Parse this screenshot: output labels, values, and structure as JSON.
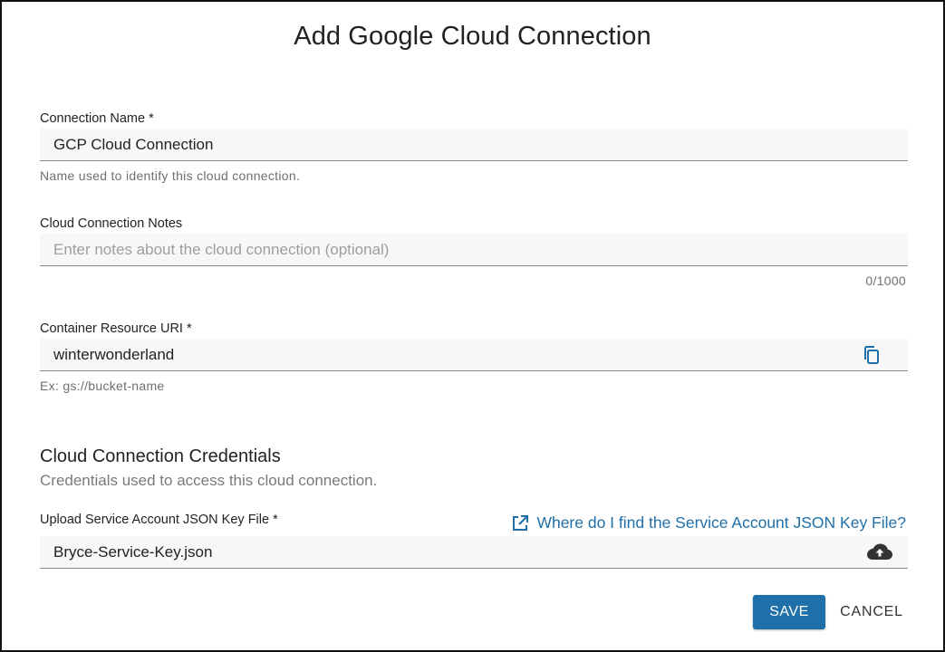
{
  "dialog": {
    "title": "Add Google Cloud Connection"
  },
  "connection_name": {
    "label": "Connection Name",
    "required_mark": "*",
    "value": "GCP Cloud Connection",
    "helper": "Name used to identify this cloud connection."
  },
  "notes": {
    "label": "Cloud Connection Notes",
    "placeholder": "Enter notes about the cloud connection (optional)",
    "counter": "0/1000"
  },
  "container_uri": {
    "label": "Container Resource URI",
    "required_mark": "*",
    "value": "winterwonderland",
    "helper": "Ex: gs://bucket-name",
    "icon": "copy-icon"
  },
  "credentials": {
    "section_title": "Cloud Connection Credentials",
    "section_subtitle": "Credentials used to access this cloud connection.",
    "upload_label": "Upload Service Account JSON Key File",
    "required_mark": "*",
    "help_link": "Where do I find the Service Account JSON Key File?",
    "help_icon": "open-in-new-icon",
    "file_value": "Bryce-Service-Key.json",
    "upload_icon": "cloud-upload-icon"
  },
  "actions": {
    "save_label": "SAVE",
    "cancel_label": "CANCEL"
  },
  "colors": {
    "accent": "#1f6fa8",
    "field_bg": "#f7f7f7",
    "helper_text": "#6f6f6f"
  }
}
